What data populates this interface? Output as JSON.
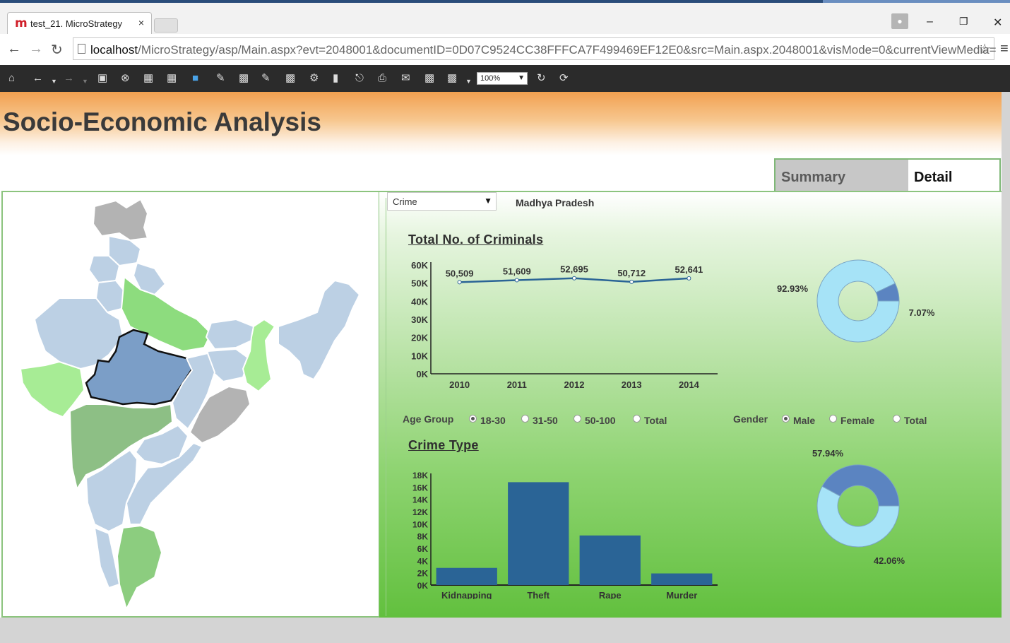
{
  "browser": {
    "tab_title": "test_21. MicroStrategy",
    "tab_close": "×",
    "url_host": "localhost",
    "url_rest": "/MicroStrategy/asp/Main.aspx?evt=2048001&documentID=0D07C9524CC38FFFCA7F499469EF12E0&src=Main.aspx.2048001&visMode=0&currentViewMedia=",
    "minimize": "–",
    "restore": "❐",
    "close": "✕"
  },
  "toolbar": {
    "zoom_value": "100%"
  },
  "page": {
    "title": "Socio-Economic Analysis",
    "tabs": [
      "Summary",
      "Detail"
    ],
    "active_tab": "Detail"
  },
  "filters": {
    "dropdown_value": "Crime",
    "state": "Madhya Pradesh"
  },
  "criminals_section": {
    "title": "Total No. of Criminals"
  },
  "crime_type_section": {
    "title": "Crime Type"
  },
  "age_group": {
    "label": "Age Group",
    "options": [
      "18-30",
      "31-50",
      "50-100",
      "Total"
    ],
    "selected": "18-30"
  },
  "gender": {
    "label": "Gender",
    "options": [
      "Male",
      "Female",
      "Total"
    ],
    "selected": "Male"
  },
  "colors": {
    "line": "#2a6496",
    "bar": "#2a6496",
    "donut_light": "#a6e3f7",
    "donut_dark": "#5b84c1"
  },
  "chart_data": [
    {
      "type": "line",
      "title": "Total No. of Criminals",
      "x": [
        "2010",
        "2011",
        "2012",
        "2013",
        "2014"
      ],
      "values": [
        50509,
        51609,
        52695,
        50712,
        52641
      ],
      "value_labels": [
        "50,509",
        "51,609",
        "52,695",
        "50,712",
        "52,641"
      ],
      "ylim": [
        0,
        60000
      ],
      "y_ticks": [
        "0K",
        "10K",
        "20K",
        "30K",
        "40K",
        "50K",
        "60K"
      ]
    },
    {
      "type": "pie",
      "slices": [
        92.93,
        7.07
      ],
      "labels": [
        "92.93%",
        "7.07%"
      ]
    },
    {
      "type": "bar",
      "title": "Crime Type",
      "categories": [
        "Kidnapping",
        "Theft",
        "Rape",
        "Murder"
      ],
      "values": [
        2800,
        16800,
        8100,
        1900
      ],
      "ylim": [
        0,
        18000
      ],
      "y_ticks": [
        "0K",
        "2K",
        "4K",
        "6K",
        "8K",
        "10K",
        "12K",
        "14K",
        "16K",
        "18K"
      ]
    },
    {
      "type": "pie",
      "slices": [
        57.94,
        42.06
      ],
      "labels": [
        "57.94%",
        "42.06%"
      ]
    }
  ]
}
